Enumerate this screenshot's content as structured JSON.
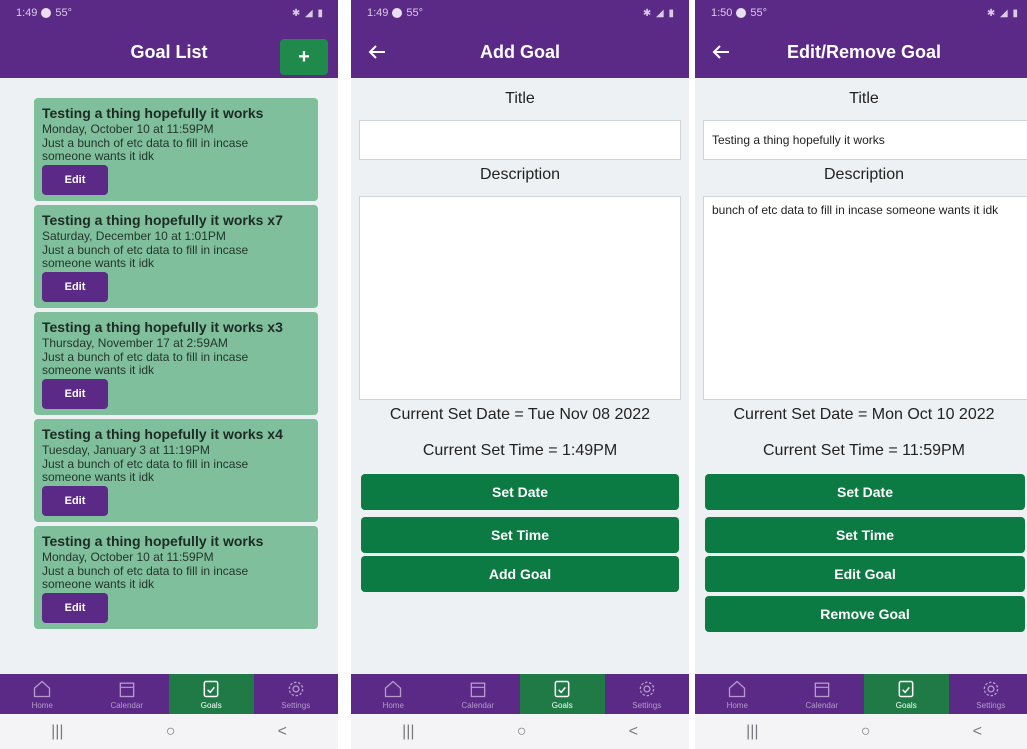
{
  "colors": {
    "primary": "#5b2a86",
    "accent": "#1f8a4c",
    "card": "#7fbf9c",
    "button": "#0c7a43"
  },
  "phone1": {
    "status_time": "1:49",
    "status_temp": "55°",
    "title": "Goal List",
    "add_label": "+",
    "goals": [
      {
        "title": "Testing a thing hopefully it works",
        "date": "Monday, October 10 at 11:59PM",
        "desc": "Just a bunch of etc data to fill in incase someone wants it idk",
        "edit": "Edit"
      },
      {
        "title": "Testing a thing hopefully it works x7",
        "date": "Saturday, December 10 at 1:01PM",
        "desc": "Just a bunch of etc data to fill in incase someone wants it idk",
        "edit": "Edit"
      },
      {
        "title": "Testing a thing hopefully it works x3",
        "date": "Thursday, November 17 at 2:59AM",
        "desc": "Just a bunch of etc data to fill in incase someone wants it idk",
        "edit": "Edit"
      },
      {
        "title": "Testing a thing hopefully it works x4",
        "date": "Tuesday, January 3 at 11:19PM",
        "desc": "Just a bunch of etc data to fill in incase someone wants it idk",
        "edit": "Edit"
      },
      {
        "title": "Testing a thing hopefully it works",
        "date": "Monday, October 10 at 11:59PM",
        "desc": "Just a bunch of etc data to fill in incase someone wants it idk",
        "edit": "Edit"
      }
    ]
  },
  "phone2": {
    "status_time": "1:49",
    "status_temp": "55°",
    "title": "Add Goal",
    "title_label": "Title",
    "title_value": "",
    "desc_label": "Description",
    "desc_value": "",
    "current_date": "Current Set Date = Tue Nov 08 2022",
    "current_time": "Current Set Time = 1:49PM",
    "set_date": "Set Date",
    "set_time": "Set Time",
    "add_goal": "Add Goal"
  },
  "phone3": {
    "status_time": "1:50",
    "status_temp": "55°",
    "title": "Edit/Remove Goal",
    "title_label": "Title",
    "title_value": "Testing a thing hopefully it works",
    "desc_label": "Description",
    "desc_value": "bunch of etc data to fill in incase someone wants it idk",
    "current_date": "Current Set Date = Mon Oct 10 2022",
    "current_time": "Current Set Time = 11:59PM",
    "set_date": "Set Date",
    "set_time": "Set Time",
    "edit_goal": "Edit Goal",
    "remove_goal": "Remove Goal"
  },
  "nav": {
    "home": "Home",
    "calendar": "Calendar",
    "goals": "Goals",
    "settings": "Settings"
  },
  "sysnav": {
    "recents": "|||",
    "home": "○",
    "back": "<"
  }
}
